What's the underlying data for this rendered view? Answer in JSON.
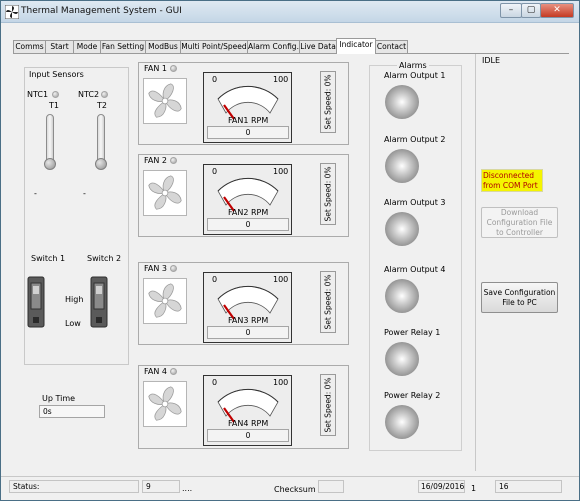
{
  "window": {
    "title": "Thermal Management System - GUI",
    "minimize": "–",
    "maximize": "▢",
    "close": "✕"
  },
  "tabs": [
    "Comms",
    "Start",
    "Mode",
    "Fan Setting",
    "ModBus",
    "Multi Point/Speed",
    "Alarm Config.",
    "Live Data",
    "Indicator",
    "Contact"
  ],
  "active_tab": "Indicator",
  "input_sensors": {
    "title": "Input Sensors",
    "ntc1": "NTC1",
    "ntc2": "NTC2",
    "t1": "T1",
    "t2": "T2",
    "t1_value": "-",
    "t2_value": "-"
  },
  "switches": {
    "switch1": "Switch 1",
    "switch2": "Switch 2",
    "high": "High",
    "low": "Low"
  },
  "uptime": {
    "label": "Up Time",
    "value": "0s"
  },
  "fans": [
    {
      "name": "FAN 1",
      "rpm_label": "FAN1 RPM",
      "rpm_value": "0",
      "scale_min": "0",
      "scale_max": "100",
      "set_speed": "Set Speed: 0%",
      "level": 0
    },
    {
      "name": "FAN 2",
      "rpm_label": "FAN2 RPM",
      "rpm_value": "0",
      "scale_min": "0",
      "scale_max": "100",
      "set_speed": "Set Speed: 0%",
      "level": 0
    },
    {
      "name": "FAN 3",
      "rpm_label": "FAN3 RPM",
      "rpm_value": "0",
      "scale_min": "0",
      "scale_max": "100",
      "set_speed": "Set Speed: 0%",
      "level": 0
    },
    {
      "name": "FAN 4",
      "rpm_label": "FAN4 RPM",
      "rpm_value": "0",
      "scale_min": "0",
      "scale_max": "100",
      "set_speed": "Set Speed: 0%",
      "level": 0
    }
  ],
  "alarms": {
    "title": "Alarms",
    "items": [
      "Alarm Output 1",
      "Alarm Output 2",
      "Alarm Output 3",
      "Alarm Output 4",
      "Power Relay 1",
      "Power Relay 2"
    ]
  },
  "right_panel": {
    "state": "IDLE",
    "connection": "Disconnected from COM Port",
    "connection_color": "#f5f500",
    "connection_text_color": "#b00000",
    "download_button": "Download Configuration File to Controller",
    "save_button": "Save Configuration File to PC"
  },
  "status_bar": {
    "status_label": "Status:",
    "status_value": "",
    "count": "9",
    "dots": "....",
    "checksum_label": "Checksum",
    "checksum_value": "",
    "date": "16/09/2016",
    "num1": "1",
    "num2": "16"
  }
}
